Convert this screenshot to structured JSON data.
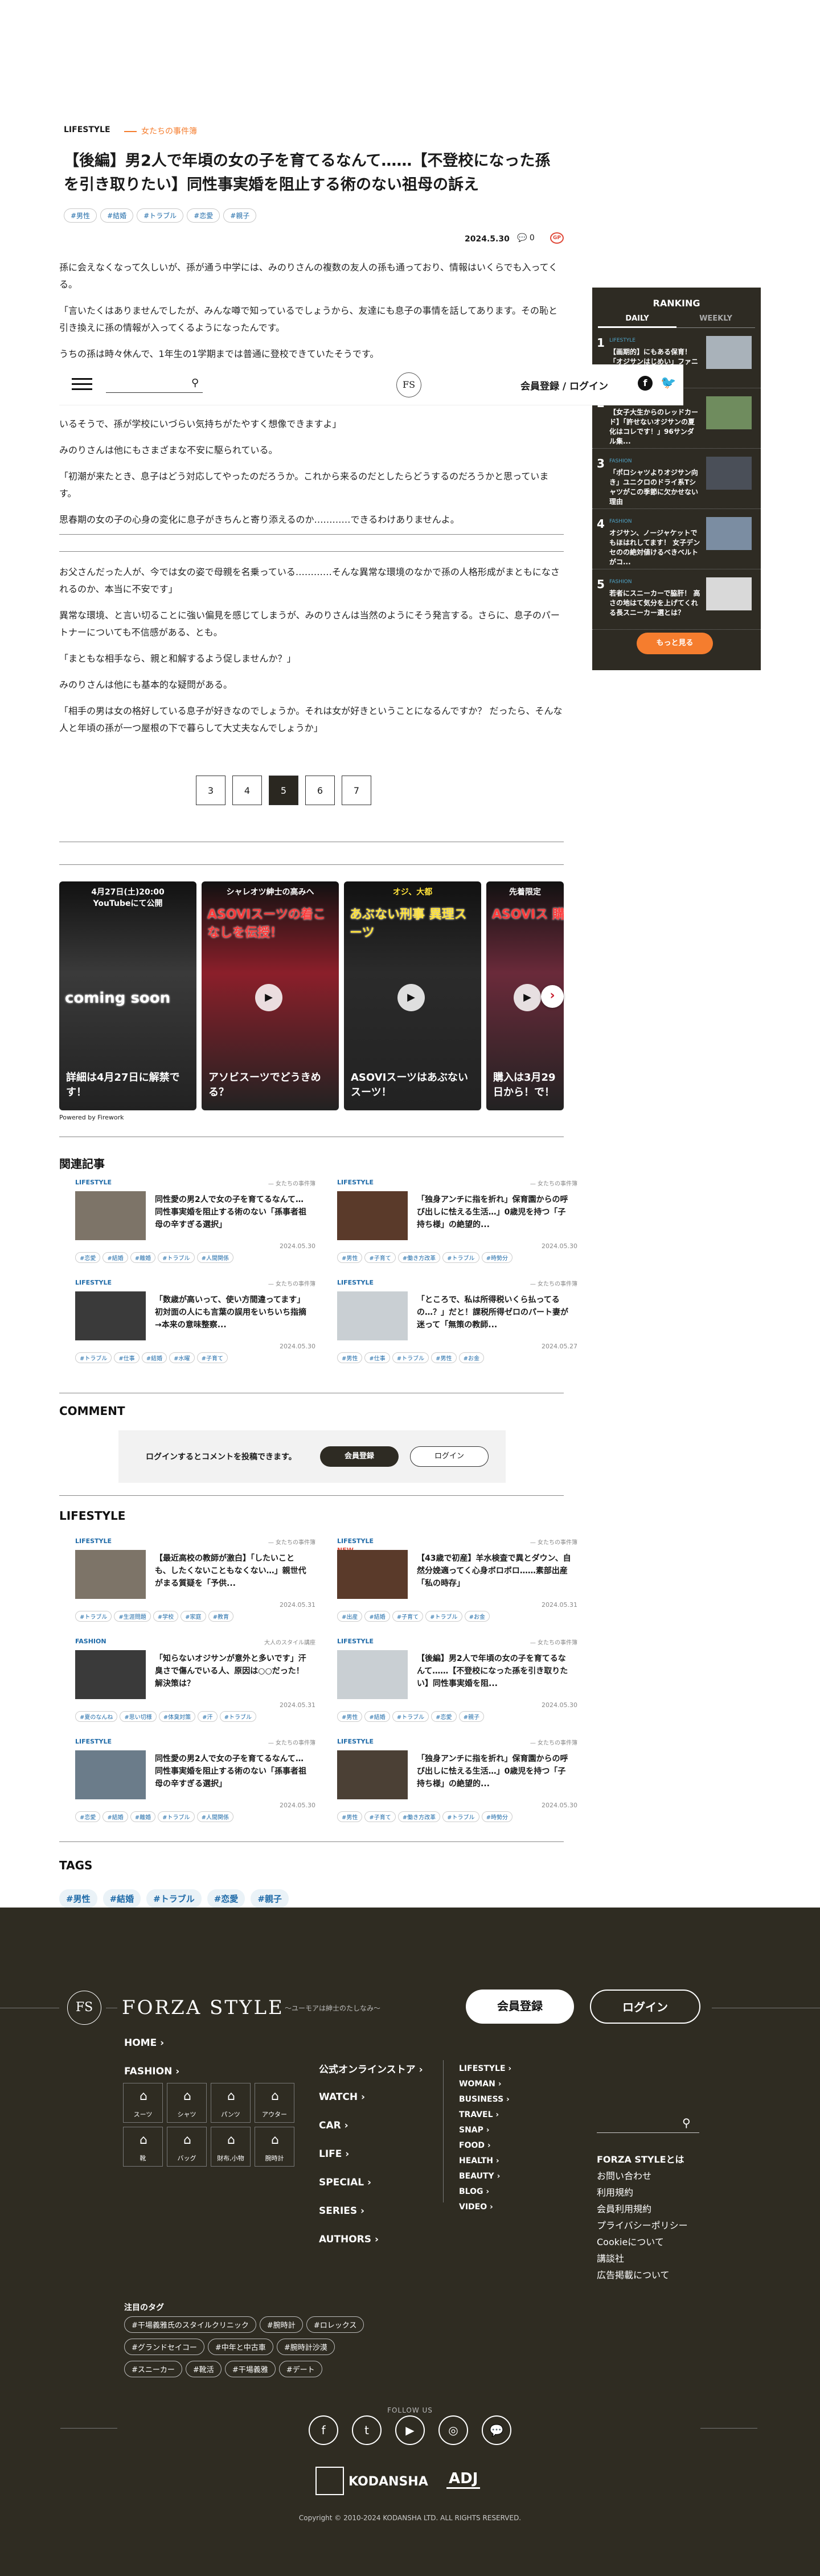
{
  "article": {
    "category": "LIFESTYLE",
    "series": "女たちの事件簿",
    "title": "【後編】男2人で年頃の女の子を育てるなんて……【不登校になった孫を引き取りたい】同性事実婚を阻止する術のない祖母の訴え",
    "tags": [
      "#男性",
      "#結婚",
      "#トラブル",
      "#恋愛",
      "#親子"
    ],
    "date": "2024.5.30",
    "comment_count": "0",
    "paragraphs_top": [
      "孫に会えなくなって久しいが、孫が通う中学には、みのりさんの複数の友人の孫も通っており、情報はいくらでも入ってくる。",
      "「言いたくはありませんでしたが、みんな噂で知っているでしょうから、友達にも息子の事情を話してあります。その恥と引き換えに孫の情報が入ってくるようになったんです。",
      "うちの孫は時々休んで、1年生の1学期までは普通に登校できていたそうです。"
    ],
    "paragraphs_mid": [
      "いるそうで、孫が学校にいづらい気持ちがたやすく想像できますよ」",
      "みのりさんは他にもさまざまな不安に駆られている。",
      "「初潮が来たとき、息子はどう対応してやったのだろうか。これから来るのだとしたらどうするのだろうかと思っています。",
      "思春期の女の子の心身の変化に息子がきちんと寄り添えるのか…………できるわけありませんよ。"
    ],
    "paragraphs_bottom": [
      "お父さんだった人が、今では女の姿で母親を名乗っている…………そんな異常な環境のなかで孫の人格形成がまともになされるのか、本当に不安です」",
      "異常な環境、と言い切ることに強い偏見を感じてしまうが、みのりさんは当然のようにそう発言する。さらに、息子のパートナーについても不信感がある、とも。",
      "「まともな相手なら、親と和解するよう促しませんか？」",
      "みのりさんは他にも基本的な疑問がある。",
      "「相手の男は女の格好している息子が好きなのでしょうか。それは女が好きということになるんですか？ だったら、そんな人と年頃の孫が一つ屋根の下で暮らして大丈夫なんでしょうか」"
    ],
    "pagination": [
      "3",
      "4",
      "5",
      "6",
      "7"
    ],
    "current_page": "5"
  },
  "header": {
    "logo": "FS",
    "login": "会員登録 / ログイン"
  },
  "ranking": {
    "title": "RANKING",
    "tab_daily": "DAILY",
    "tab_weekly": "WEEKLY",
    "items": [
      {
        "num": "1",
        "cat": "LIFESTYLE",
        "title": "【画期的】にもある保育！「オジサンはじめい」ファニア...で..."
      },
      {
        "num": "2",
        "cat": "FASHION",
        "title": "【女子大生からのレッドカード】「許せないオジサンの夏化はコレです！」96サンダル集..."
      },
      {
        "num": "3",
        "cat": "FASHION",
        "title": "「ポロシャツよりオジサン向き」ユニクロのドライ系Tシャツがこの季節に欠かせない理由"
      },
      {
        "num": "4",
        "cat": "FASHION",
        "title": "オジサン、ノージャケットでもほはれしてます！ 女子デンセのの絶対値けるべきベルトがコ..."
      },
      {
        "num": "5",
        "cat": "FASHION",
        "title": "若者にスニーカーで脇肝！ 高さの地はて気分を上げてくれる長スニーカー選とは？"
      }
    ],
    "more": "もっと見る"
  },
  "videos": {
    "cards": [
      {
        "top": "4月27日(土)20:00\nYouTubeにて公開",
        "caption": "詳細は4月27日に解禁です！",
        "mark": "coming soon"
      },
      {
        "top": "シャレオツ紳士の高みへ",
        "caption": "アソビスーツでどうきめる？",
        "mark": "ASOVIスーツの着こなしを伝授！"
      },
      {
        "top": "オジ、大都",
        "caption": "ASOVIスーツはあぶないスーツ！",
        "mark": "あぶない刑事 異理スーツ"
      },
      {
        "top": "先着限定",
        "caption": "購入は3月29日から！で！",
        "mark": "ASOVIス 購入方"
      }
    ],
    "powered": "Powered by Firework"
  },
  "related": {
    "heading": "関連記事",
    "items": [
      {
        "cat": "LIFESTYLE",
        "author": "— 女たちの事件簿",
        "title": "同性愛の男2人で女の子を育てるなんて…同性事実婚を阻止する術のない「孫事者祖母の辛すぎる選択」",
        "date": "2024.05.30",
        "tags": [
          "#恋愛",
          "#結婚",
          "#離婚",
          "#トラブル",
          "#人間関係"
        ]
      },
      {
        "cat": "LIFESTYLE",
        "author": "— 女たちの事件簿",
        "title": "「独身アンチに指を折れ」保育園からの呼び出しに怯える生活…」0歳児を持つ「子持ち様」の絶望的...",
        "date": "2024.05.30",
        "tags": [
          "#男性",
          "#子育て",
          "#働き方改革",
          "#トラブル",
          "#時勢分"
        ]
      },
      {
        "cat": "LIFESTYLE",
        "author": "— 女たちの事件簿",
        "title": "「数歳が高いって、使い方間違ってます」初対面の人にも言葉の誤用をいちいち指摘→本来の意味整察...",
        "date": "2024.05.30",
        "tags": [
          "#トラブル",
          "#仕事",
          "#結婚",
          "#水曜",
          "#子育て"
        ]
      },
      {
        "cat": "LIFESTYLE",
        "author": "— 女たちの事件簿",
        "title": "「ところで、私は所得税いくら払ってるの…？」だと！課税所得ゼロのパート妻が迷って「無策の教師...",
        "date": "2024.05.27",
        "tags": [
          "#男性",
          "#仕事",
          "#トラブル",
          "#男性",
          "#お金"
        ]
      }
    ]
  },
  "comment": {
    "heading": "COMMENT",
    "prompt": "ログインするとコメントを投稿できます。",
    "register": "会員登録",
    "login": "ログイン"
  },
  "lifestyle": {
    "heading": "LIFESTYLE",
    "items": [
      {
        "cat": "LIFESTYLE",
        "badge": "",
        "author": "— 女たちの事件簿",
        "title": "【最近高校の教師が激白】「したいことも、したくないこともなくない…」親世代がまる質疑を「予供...",
        "date": "2024.05.31",
        "tags": [
          "#トラブル",
          "#生涯問題",
          "#学校",
          "#家庭",
          "#教育"
        ]
      },
      {
        "cat": "LIFESTYLE",
        "badge": "NEW",
        "author": "— 女たちの事件簿",
        "title": "【43歳で初産】羊水検査で異とダウン、自然分娩適ってく心身ボロボロ……素部出産「私の時存」",
        "date": "2024.05.31",
        "tags": [
          "#出産",
          "#結婚",
          "#子育て",
          "#トラブル",
          "#お金"
        ]
      },
      {
        "cat": "FASHION",
        "badge": "",
        "author": "大人のスタイル講座",
        "title": "「知らないオジサンが意外と多いです」汗臭さで傷んでいる人、原因は○○だった！ 解決策は？",
        "date": "2024.05.31",
        "tags": [
          "#夏のなんね",
          "#思い切様",
          "#体臭対策",
          "#汗",
          "#トラブル"
        ]
      },
      {
        "cat": "LIFESTYLE",
        "badge": "",
        "author": "— 女たちの事件簿",
        "title": "【後編】男2人で年頃の女の子を育てるなんて……【不登校になった孫を引き取りたい】同性事実婚を阻...",
        "date": "2024.05.30",
        "tags": [
          "#男性",
          "#結婚",
          "#トラブル",
          "#恋愛",
          "#親子"
        ]
      },
      {
        "cat": "LIFESTYLE",
        "badge": "",
        "author": "— 女たちの事件簿",
        "title": "同性愛の男2人で女の子を育てるなんて…同性事実婚を阻止する術のない「孫事者祖母の辛すぎる選択」",
        "date": "2024.05.30",
        "tags": [
          "#恋愛",
          "#結婚",
          "#離婚",
          "#トラブル",
          "#人間関係"
        ]
      },
      {
        "cat": "LIFESTYLE",
        "badge": "",
        "author": "— 女たちの事件簿",
        "title": "「独身アンチに指を折れ」保育園からの呼び出しに怯える生活…」0歳児を持つ「子持ち様」の絶望的...",
        "date": "2024.05.30",
        "tags": [
          "#男性",
          "#子育て",
          "#働き方改革",
          "#トラブル",
          "#時勢分"
        ]
      }
    ]
  },
  "tags_section": {
    "heading": "TAGS",
    "tags": [
      "#男性",
      "#結婚",
      "#トラブル",
      "#恋愛",
      "#親子"
    ]
  },
  "footer": {
    "logo_mark": "FS",
    "logo_text": "FORZA STYLE",
    "tagline": "〜ユーモアは紳士のたしなみ〜",
    "register": "会員登録",
    "login": "ログイン",
    "home": "HOME",
    "fashion": "FASHION",
    "fashion_items": [
      "スーツ",
      "シャツ",
      "パンツ",
      "アウター",
      "靴",
      "バッグ",
      "財布,小物",
      "腕時計"
    ],
    "col2": [
      "公式オンラインストア",
      "WATCH",
      "CAR",
      "LIFE",
      "SPECIAL",
      "SERIES",
      "AUTHORS"
    ],
    "col3": [
      "LIFESTYLE",
      "WOMAN",
      "BUSINESS",
      "TRAVEL",
      "SNAP",
      "FOOD",
      "HEALTH",
      "BEAUTY",
      "BLOG",
      "VIDEO"
    ],
    "links": [
      "FORZA STYLEとは",
      "お問い合わせ",
      "利用規約",
      "会員利用規約",
      "プライバシーポリシー",
      "Cookieについて",
      "講談社",
      "広告掲載について"
    ],
    "search_placeholder": "",
    "featured_tags_heading": "注目のタグ",
    "featured_tags": [
      "#干場義雅氏のスタイルクリニック",
      "#腕時計",
      "#ロレックス",
      "#グランドセイコー",
      "#中年と中古車",
      "#腕時計沙漠",
      "#スニーカー",
      "#靴活",
      "#干場義雅",
      "#デート"
    ],
    "follow": "FOLLOW US",
    "social": [
      "f",
      "t",
      "▶",
      "◎",
      "💬"
    ],
    "kodansha": "KODANSHA",
    "adj": "ADJ",
    "copyright": "Copyright © 2010-2024 KODANSHA LTD. ALL RIGHTS RESERVED."
  },
  "colors": {
    "dark": "#2e2b23",
    "accent": "#f57d2e",
    "link": "#1e6aa8"
  }
}
